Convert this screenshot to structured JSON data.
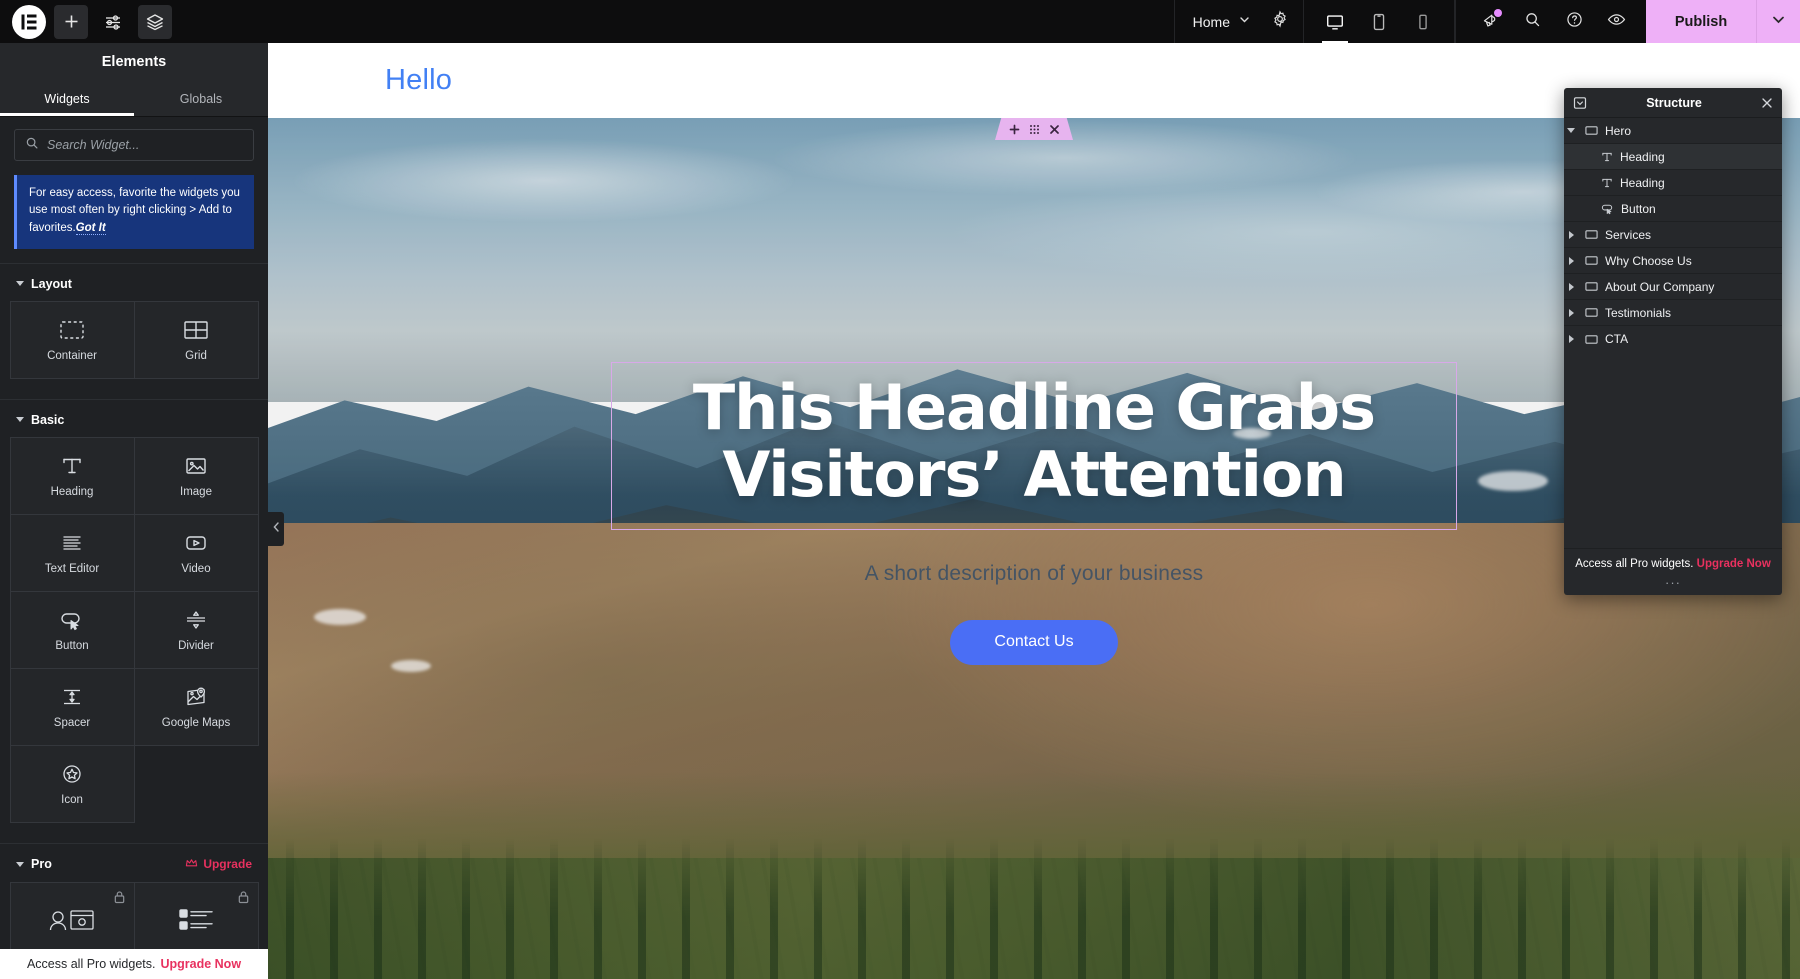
{
  "topbar": {
    "logo_icon": "elementor-logo-icon",
    "add_icon": "plus-icon",
    "settings_sliders_icon": "sliders-icon",
    "layers_icon": "layers-icon",
    "page_label": "Home",
    "page_caret_icon": "chevron-down-icon",
    "gear_icon": "gear-icon",
    "devices": [
      {
        "name": "desktop",
        "icon": "desktop-icon",
        "selected": true
      },
      {
        "name": "tablet",
        "icon": "tablet-icon",
        "selected": false
      },
      {
        "name": "mobile",
        "icon": "mobile-icon",
        "selected": false
      }
    ],
    "right_icons": [
      {
        "name": "whats-new",
        "icon": "megaphone-icon",
        "badge": true
      },
      {
        "name": "finder",
        "icon": "search-icon",
        "badge": false
      },
      {
        "name": "help",
        "icon": "question-circle-icon",
        "badge": false
      },
      {
        "name": "preview",
        "icon": "eye-icon",
        "badge": false
      }
    ],
    "publish_label": "Publish",
    "publish_caret_icon": "chevron-down-icon",
    "publish_color": "#eeb0f7"
  },
  "panel": {
    "title": "Elements",
    "tabs": [
      {
        "label": "Widgets",
        "active": true
      },
      {
        "label": "Globals",
        "active": false
      }
    ],
    "search": {
      "placeholder": "Search Widget...",
      "value": "",
      "icon": "search-icon"
    },
    "notice": {
      "text": "For easy access, favorite the widgets you use most often by right clicking > Add to favorites.",
      "action": "Got It"
    },
    "categories": [
      {
        "title": "Layout",
        "collapse_icon": "chevron-down-icon",
        "widgets": [
          {
            "label": "Container",
            "icon": "container-icon"
          },
          {
            "label": "Grid",
            "icon": "grid-icon"
          }
        ]
      },
      {
        "title": "Basic",
        "collapse_icon": "chevron-down-icon",
        "widgets": [
          {
            "label": "Heading",
            "icon": "heading-icon"
          },
          {
            "label": "Image",
            "icon": "image-icon"
          },
          {
            "label": "Text Editor",
            "icon": "text-editor-icon"
          },
          {
            "label": "Video",
            "icon": "video-icon"
          },
          {
            "label": "Button",
            "icon": "button-icon"
          },
          {
            "label": "Divider",
            "icon": "divider-icon"
          },
          {
            "label": "Spacer",
            "icon": "spacer-icon"
          },
          {
            "label": "Google Maps",
            "icon": "google-maps-icon"
          },
          {
            "label": "Icon",
            "icon": "star-circle-icon"
          }
        ]
      },
      {
        "title": "Pro",
        "collapse_icon": "chevron-down-icon",
        "upgrade_label": "Upgrade",
        "upgrade_icon": "crown-icon",
        "widgets": [
          {
            "label": "",
            "icon": "pro-posts-icon",
            "locked": true
          },
          {
            "label": "",
            "icon": "pro-list-icon",
            "locked": true
          }
        ]
      }
    ],
    "footer": {
      "text": "Access all Pro widgets.",
      "link": "Upgrade Now"
    },
    "collapse_icon": "chevron-left-icon"
  },
  "canvas": {
    "site_logo": "Hello",
    "container_tab": {
      "add_icon": "plus-icon",
      "drag_icon": "drag-handle-icon",
      "close_icon": "close-icon",
      "color": "#e7b4ef"
    },
    "hero": {
      "headline": "This Headline Grabs Visitors’ Attention",
      "subheadline": "A short description of your business",
      "cta_label": "Contact Us",
      "cta_color": "#4a6ef5",
      "selection_border_color": "#d8a8e8"
    }
  },
  "structure": {
    "title": "Structure",
    "minimize_icon": "minimize-icon",
    "close_icon": "close-icon",
    "items": [
      {
        "label": "Hero",
        "type_icon": "container-icon",
        "depth": 0,
        "expanded": true,
        "has_children": true,
        "selected": false
      },
      {
        "label": "Heading",
        "type_icon": "heading-icon",
        "depth": 1,
        "expanded": false,
        "has_children": false,
        "selected": true
      },
      {
        "label": "Heading",
        "type_icon": "heading-icon",
        "depth": 1,
        "expanded": false,
        "has_children": false,
        "selected": false
      },
      {
        "label": "Button",
        "type_icon": "button-icon",
        "depth": 1,
        "expanded": false,
        "has_children": false,
        "selected": false
      },
      {
        "label": "Services",
        "type_icon": "container-icon",
        "depth": 0,
        "expanded": false,
        "has_children": true,
        "selected": false
      },
      {
        "label": "Why Choose Us",
        "type_icon": "container-icon",
        "depth": 0,
        "expanded": false,
        "has_children": true,
        "selected": false
      },
      {
        "label": "About Our Company",
        "type_icon": "container-icon",
        "depth": 0,
        "expanded": false,
        "has_children": true,
        "selected": false
      },
      {
        "label": "Testimonials",
        "type_icon": "container-icon",
        "depth": 0,
        "expanded": false,
        "has_children": true,
        "selected": false
      },
      {
        "label": "CTA",
        "type_icon": "container-icon",
        "depth": 0,
        "expanded": false,
        "has_children": true,
        "selected": false
      }
    ],
    "footer": {
      "text": "Access all Pro widgets.",
      "link": "Upgrade Now"
    },
    "resize_handle": "···"
  }
}
